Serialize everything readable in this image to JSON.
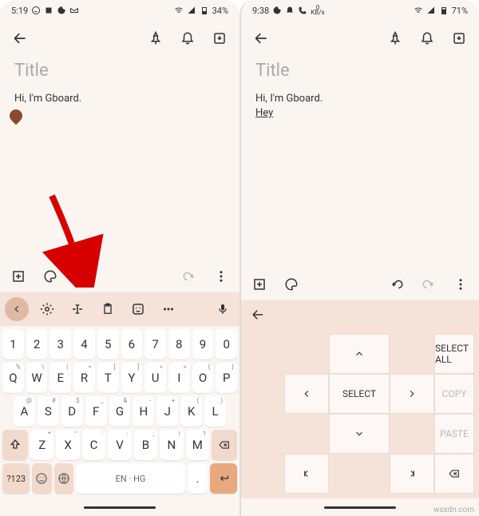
{
  "watermark": "wsxdn.com",
  "left": {
    "status": {
      "time": "5:19",
      "battery": "34%"
    },
    "note": {
      "title_placeholder": "Title",
      "body": "Hi, I'm Gboard."
    },
    "keyboard": {
      "row1": [
        "1",
        "2",
        "3",
        "4",
        "5",
        "6",
        "7",
        "8",
        "9",
        "0"
      ],
      "row2": [
        "Q",
        "W",
        "E",
        "R",
        "T",
        "Y",
        "U",
        "I",
        "O",
        "P"
      ],
      "row2sup": [
        "%",
        "\\",
        "|",
        "=",
        "[",
        "]",
        "<",
        ">",
        "{",
        "}"
      ],
      "row3": [
        "A",
        "S",
        "D",
        "F",
        "G",
        "H",
        "J",
        "K",
        "L"
      ],
      "row3sup": [
        "@",
        "#",
        "$",
        "_",
        "&",
        "-",
        "+",
        "(",
        ")"
      ],
      "row4": [
        "Z",
        "X",
        "C",
        "V",
        "B",
        "N",
        "M"
      ],
      "row4sup": [
        "*",
        "\"",
        "'",
        ":",
        ";",
        "!",
        "?"
      ],
      "sym": "?123",
      "space": "EN · HG"
    }
  },
  "right": {
    "status": {
      "time": "9:38",
      "kbps": "0",
      "kbps_unit": "KB/s",
      "battery": "71%"
    },
    "note": {
      "title_placeholder": "Title",
      "body1": "Hi, I'm Gboard.",
      "body2": "Hey"
    },
    "nav": {
      "select": "SELECT",
      "select_all": "SELECT ALL",
      "copy": "COPY",
      "paste": "PASTE"
    }
  }
}
